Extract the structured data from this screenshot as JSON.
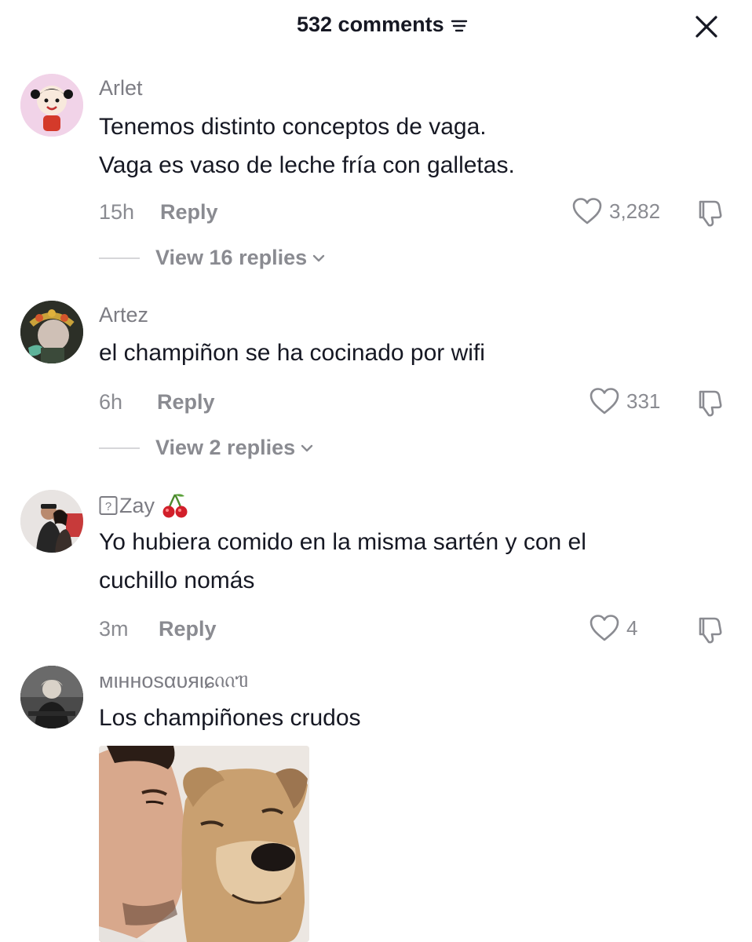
{
  "header": {
    "title": "532 comments",
    "filter_icon": "filter-lines-icon",
    "close_icon": "close-icon"
  },
  "comments": [
    {
      "username": "Arlet",
      "text_lines": [
        "Tenemos distinto conceptos de vaga.",
        "Vaga es vaso de leche fría con galletas."
      ],
      "time": "15h",
      "reply_label": "Reply",
      "likes": "3,282",
      "view_replies": "View 16 replies"
    },
    {
      "username": "Artez",
      "text_lines": [
        "el champiñon se ha cocinado por wifi"
      ],
      "time": "6h",
      "reply_label": "Reply",
      "likes": "331",
      "view_replies": "View 2 replies"
    },
    {
      "username": "Zay",
      "username_prefix": "?",
      "username_emoji": "🍒",
      "text_lines": [
        "Yo hubiera comido en la misma sartén y con el",
        "cuchillo nomás"
      ],
      "time": "3m",
      "reply_label": "Reply",
      "likes": "4"
    },
    {
      "username": "мιнноsαυяιɕ",
      "username_suffix": "ᦶᥓ",
      "text_lines": [
        "Los champiñones crudos"
      ],
      "media": "man kissing dog photo"
    }
  ],
  "colors": {
    "primary_text": "#161823",
    "secondary_text": "#8a8b91",
    "username": "#7c7c83",
    "background": "#ffffff"
  }
}
